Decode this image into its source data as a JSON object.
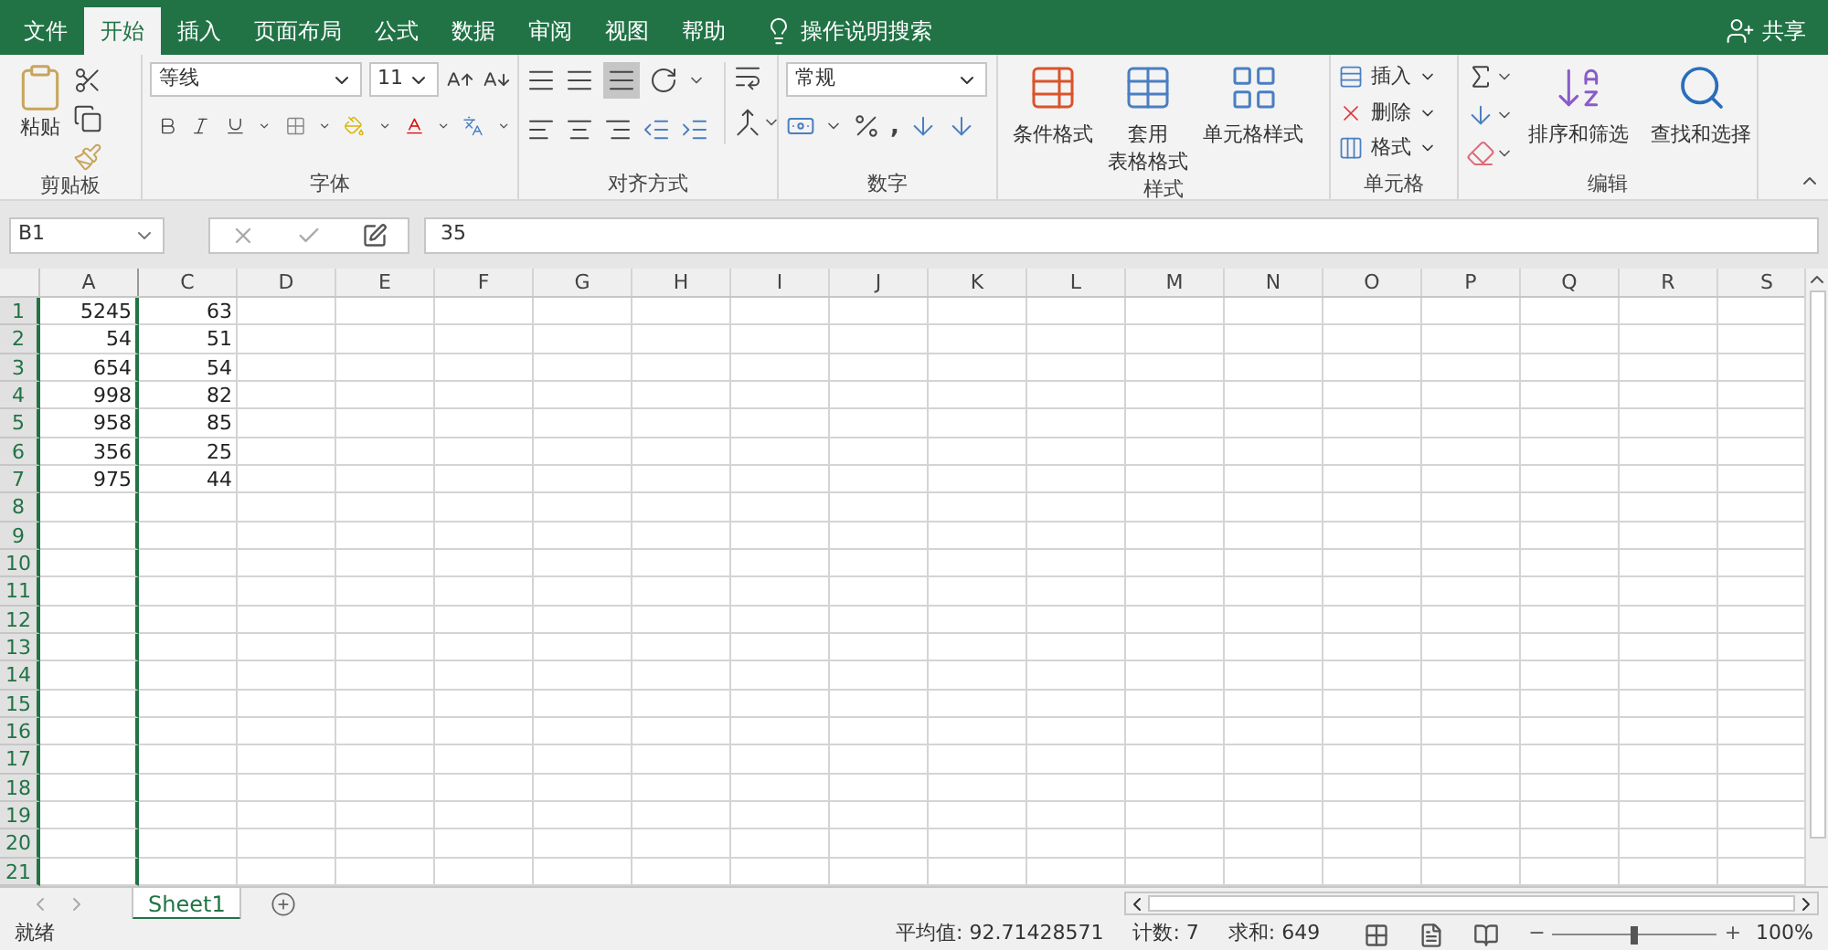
{
  "menu_tabs": [
    {
      "label": "文件",
      "selected": false
    },
    {
      "label": "开始",
      "selected": true
    },
    {
      "label": "插入",
      "selected": false
    },
    {
      "label": "页面布局",
      "selected": false
    },
    {
      "label": "公式",
      "selected": false
    },
    {
      "label": "数据",
      "selected": false
    },
    {
      "label": "审阅",
      "selected": false
    },
    {
      "label": "视图",
      "selected": false
    },
    {
      "label": "帮助",
      "selected": false
    }
  ],
  "search": {
    "placeholder": "操作说明搜索"
  },
  "share": "共享",
  "ribbon": {
    "clipboard": {
      "paste": "粘贴",
      "label": "剪贴板"
    },
    "font": {
      "name": "等线",
      "size": "11",
      "label": "字体"
    },
    "alignment": {
      "label": "对齐方式"
    },
    "number": {
      "format": "常规",
      "comma": ",",
      "label": "数字"
    },
    "styles": {
      "items": [
        [
          "条件格式"
        ],
        [
          "套用",
          "表格格式"
        ],
        [
          "单元格样式"
        ]
      ],
      "label": "样式"
    },
    "cells": {
      "items": [
        "插入",
        "删除",
        "格式"
      ],
      "label": "单元格"
    },
    "editing": {
      "items": [
        "排序和筛选",
        "查找和选择"
      ],
      "label": "编辑"
    }
  },
  "name_box": "B1",
  "formula": "35",
  "columns": [
    "A",
    "C",
    "D",
    "E",
    "F",
    "G",
    "H",
    "I",
    "J",
    "K",
    "L",
    "M",
    "N",
    "O",
    "P",
    "Q",
    "R",
    "S"
  ],
  "rows": [
    {
      "header": "1",
      "cells": [
        "5245",
        "63"
      ]
    },
    {
      "header": "2",
      "cells": [
        "54",
        "51"
      ]
    },
    {
      "header": "3",
      "cells": [
        "654",
        "54"
      ]
    },
    {
      "header": "4",
      "cells": [
        "998",
        "82"
      ]
    },
    {
      "header": "5",
      "cells": [
        "958",
        "85"
      ]
    },
    {
      "header": "6",
      "cells": [
        "356",
        "25"
      ]
    },
    {
      "header": "7",
      "cells": [
        "975",
        "44"
      ]
    },
    {
      "header": "8",
      "cells": []
    },
    {
      "header": "9",
      "cells": []
    },
    {
      "header": "10",
      "cells": []
    },
    {
      "header": "11",
      "cells": []
    },
    {
      "header": "12",
      "cells": []
    },
    {
      "header": "13",
      "cells": []
    },
    {
      "header": "14",
      "cells": []
    },
    {
      "header": "15",
      "cells": []
    },
    {
      "header": "16",
      "cells": []
    },
    {
      "header": "17",
      "cells": []
    },
    {
      "header": "18",
      "cells": []
    },
    {
      "header": "19",
      "cells": []
    },
    {
      "header": "20",
      "cells": []
    },
    {
      "header": "21",
      "cells": []
    }
  ],
  "sheet_tabs": [
    {
      "label": "Sheet1",
      "selected": true
    }
  ],
  "status_bar": {
    "mode": "就绪",
    "average": "平均值: 92.71428571",
    "count": "计数: 7",
    "sum": "求和: 649",
    "zoom": {
      "out": "−",
      "level": 0.5,
      "in": "+",
      "reading": "100%"
    }
  }
}
